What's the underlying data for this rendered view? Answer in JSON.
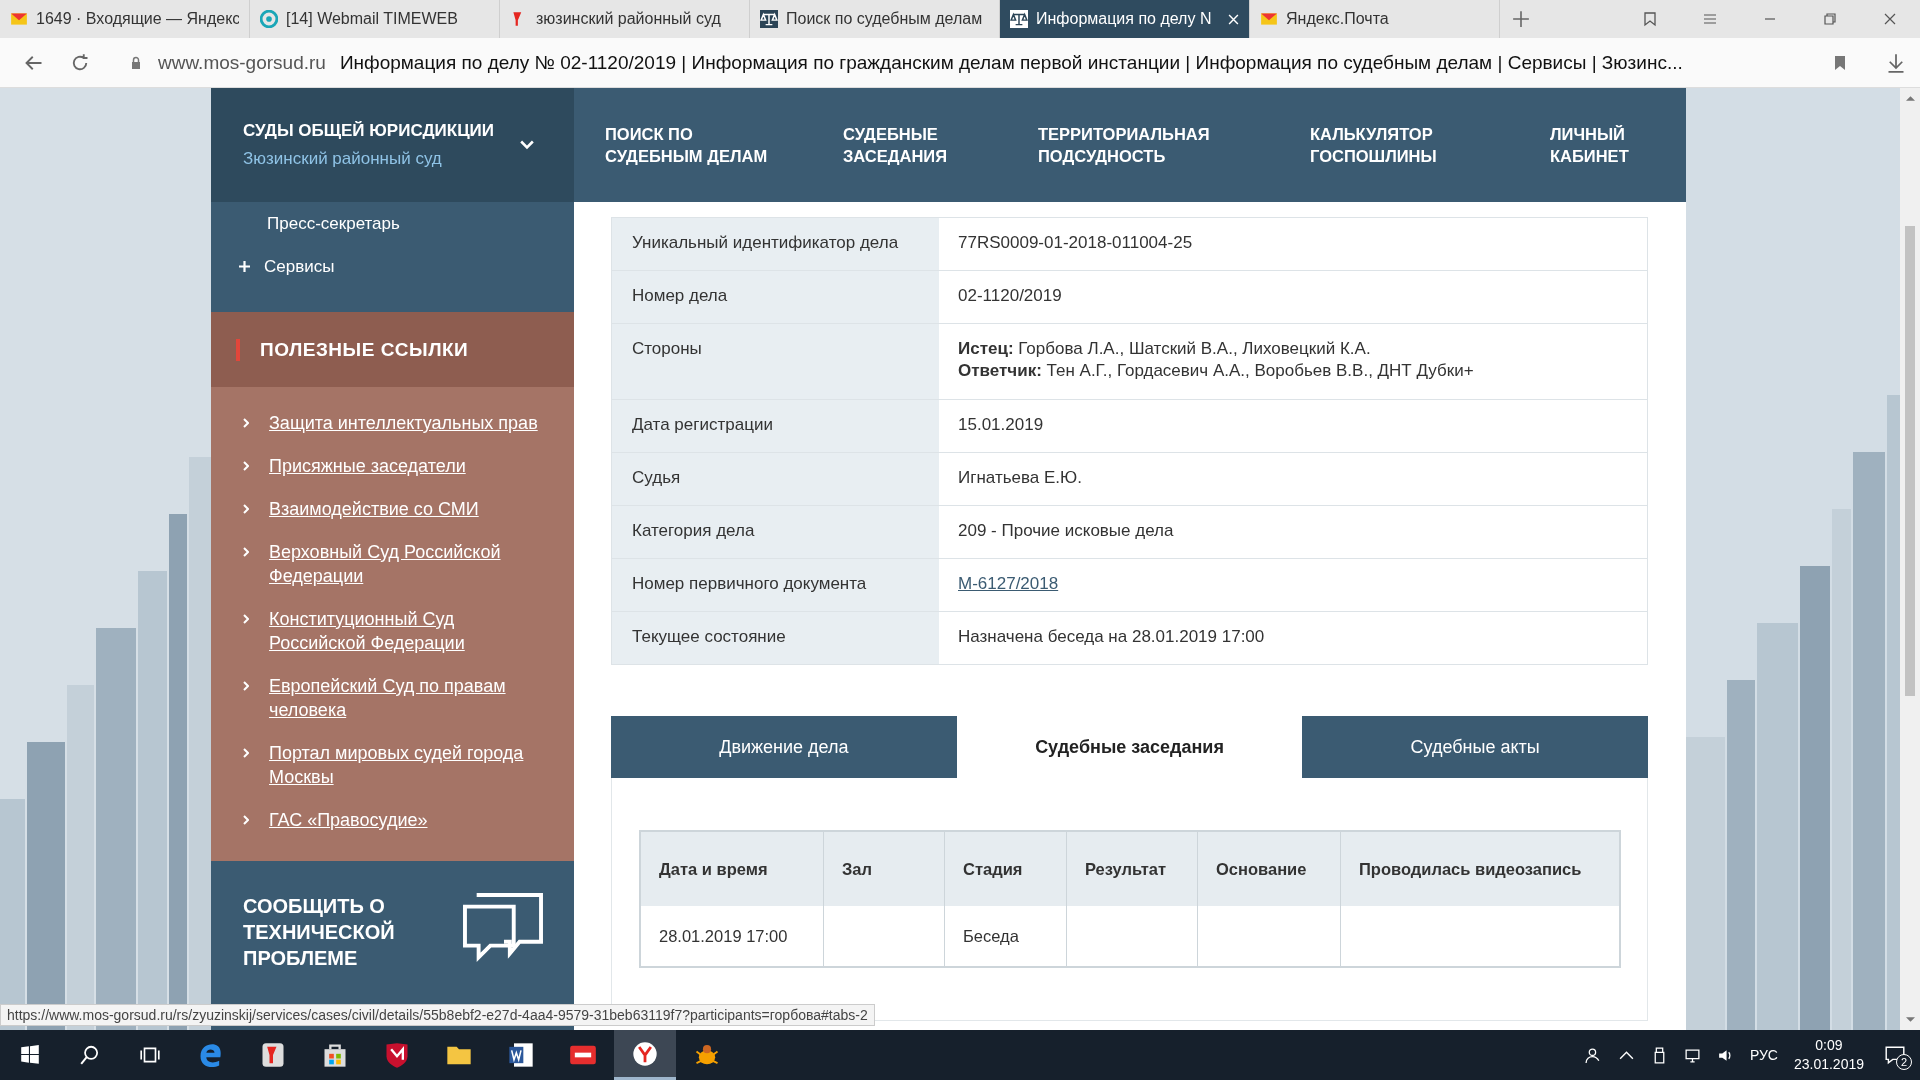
{
  "browser_tabs": [
    {
      "title": "1649 · Входящие — Яндекс",
      "kind": "mail",
      "selected": false
    },
    {
      "title": "[14] Webmail TIMEWEB",
      "kind": "swirl",
      "selected": false
    },
    {
      "title": "зюзинский районный суд",
      "kind": "ya",
      "selected": false
    },
    {
      "title": "Поиск по судебным делам",
      "kind": "court",
      "selected": false
    },
    {
      "title": "Информация по делу N",
      "kind": "court",
      "selected": true
    },
    {
      "title": "Яндекс.Почта",
      "kind": "mail",
      "selected": false
    }
  ],
  "address_bar": {
    "domain": "www.mos-gorsud.ru",
    "page_title": "Информация по делу № 02-1120/2019 | Информация по гражданским делам первой инстанции | Информация по судебным делам | Сервисы | Зюзинс..."
  },
  "nav": {
    "court_selector": {
      "title": "СУДЫ ОБЩЕЙ ЮРИСДИКЦИИ",
      "subtitle": "Зюзинский районный суд"
    },
    "items": [
      "ПОИСК ПО\nСУДЕБНЫМ ДЕЛАМ",
      "СУДЕБНЫЕ\nЗАСЕДАНИЯ",
      "ТЕРРИТОРИАЛЬНАЯ\nПОДСУДНОСТЬ",
      "КАЛЬКУЛЯТОР\nГОСПОШЛИНЫ",
      "ЛИЧНЫЙ\nКАБИНЕТ"
    ]
  },
  "sidebar": {
    "items": [
      {
        "label": "Пресс-секретарь",
        "kind": "plain"
      },
      {
        "label": "Сервисы",
        "kind": "expandable"
      }
    ],
    "useful_links": {
      "title": "ПОЛЕЗНЫЕ ССЫЛКИ",
      "links": [
        "Защита интеллектуальных прав",
        "Присяжные заседатели",
        "Взаимодействие со СМИ",
        "Верховный Суд Российской Федерации",
        "Конституционный Суд Российской Федерации",
        "Европейский Суд по правам человека",
        "Портал мировых судей города Москвы",
        "ГАС «Правосудие»"
      ]
    },
    "report": {
      "title": "СООБЩИТЬ О ТЕХНИЧЕСКОЙ ПРОБЛЕМЕ"
    }
  },
  "case_details": [
    {
      "label": "Уникальный идентификатор дела",
      "kind": "text",
      "value": "77RS0009-01-2018-011004-25"
    },
    {
      "label": "Номер дела",
      "kind": "text",
      "value": "02-1120/2019"
    },
    {
      "label": "Стороны",
      "kind": "lines",
      "lines": [
        "**Истец:** Горбова Л.А., Шатский В.А., Лиховецкий К.А.",
        "**Ответчик:** Тен А.Г., Гордасевич А.А., Воробьев В.В., ДНТ Дубки+"
      ]
    },
    {
      "label": "Дата регистрации",
      "kind": "text",
      "value": "15.01.2019"
    },
    {
      "label": "Судья",
      "kind": "text",
      "value": "Игнатьева Е.Ю."
    },
    {
      "label": "Категория дела",
      "kind": "text",
      "value": "209 - Прочие исковые дела"
    },
    {
      "label": "Номер первичного документа",
      "kind": "link",
      "value": "М-6127/2018"
    },
    {
      "label": "Текущее состояние",
      "kind": "text",
      "value": "Назначена беседа на 28.01.2019 17:00"
    }
  ],
  "case_tabs": [
    {
      "label": "Движение дела",
      "selected": false
    },
    {
      "label": "Судебные заседания",
      "selected": true
    },
    {
      "label": "Судебные акты",
      "selected": false
    }
  ],
  "hearings": {
    "columns": [
      "Дата и время",
      "Зал",
      "Стадия",
      "Результат",
      "Основание",
      "Проводилась видеозапись"
    ],
    "rows": [
      [
        "28.01.2019 17:00",
        "",
        "Беседа",
        "",
        "",
        ""
      ]
    ]
  },
  "status_url": "https://www.mos-gorsud.ru/rs/zyuzinskij/services/cases/civil/details/55b8ebf2-e27d-4aa4-9579-31beb63119f7?participants=горбова#tabs-2",
  "taskbar": {
    "apps": [
      {
        "kind": "edge",
        "selected": false
      },
      {
        "kind": "ya",
        "selected": false
      },
      {
        "kind": "store",
        "selected": false
      },
      {
        "kind": "shield",
        "selected": false
      },
      {
        "kind": "folder",
        "selected": false
      },
      {
        "kind": "word",
        "selected": false
      },
      {
        "kind": "pdf",
        "selected": false
      },
      {
        "kind": "yabrowser",
        "selected": true
      },
      {
        "kind": "bug",
        "selected": false
      }
    ],
    "language": "РУС",
    "time": "0:09",
    "date": "23.01.2019",
    "notifications": "2"
  }
}
